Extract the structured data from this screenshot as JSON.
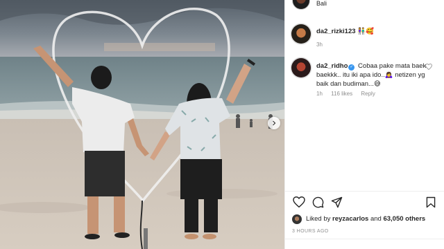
{
  "post": {
    "photo_alt": "Couple on the beach with a heart outline",
    "next_label": "›"
  },
  "prev_comment": {
    "text": "Bali"
  },
  "comments": [
    {
      "username": "da2_rizki123",
      "text": "👫🥰",
      "time": "3h"
    },
    {
      "username": "da2_ridho",
      "verified": "✓",
      "text": "Cobaa pake mata baek baekkk.. itu iki apa ido..🙇‍♀️ netizen yg baik dan budiman...😅",
      "time": "1h",
      "likes": "116 likes",
      "reply": "Reply"
    }
  ],
  "likes": {
    "prefix": "Liked by",
    "user": "reyzacarlos",
    "middle": "and",
    "count": "63,050 others"
  },
  "timestamp": "3 HOURS AGO",
  "colors": {
    "verified": "#3897f0",
    "muted": "#8e8e8e",
    "text": "#262626"
  },
  "icons": [
    "like-icon",
    "comment-icon",
    "share-icon",
    "save-icon",
    "chevron-right-icon"
  ]
}
